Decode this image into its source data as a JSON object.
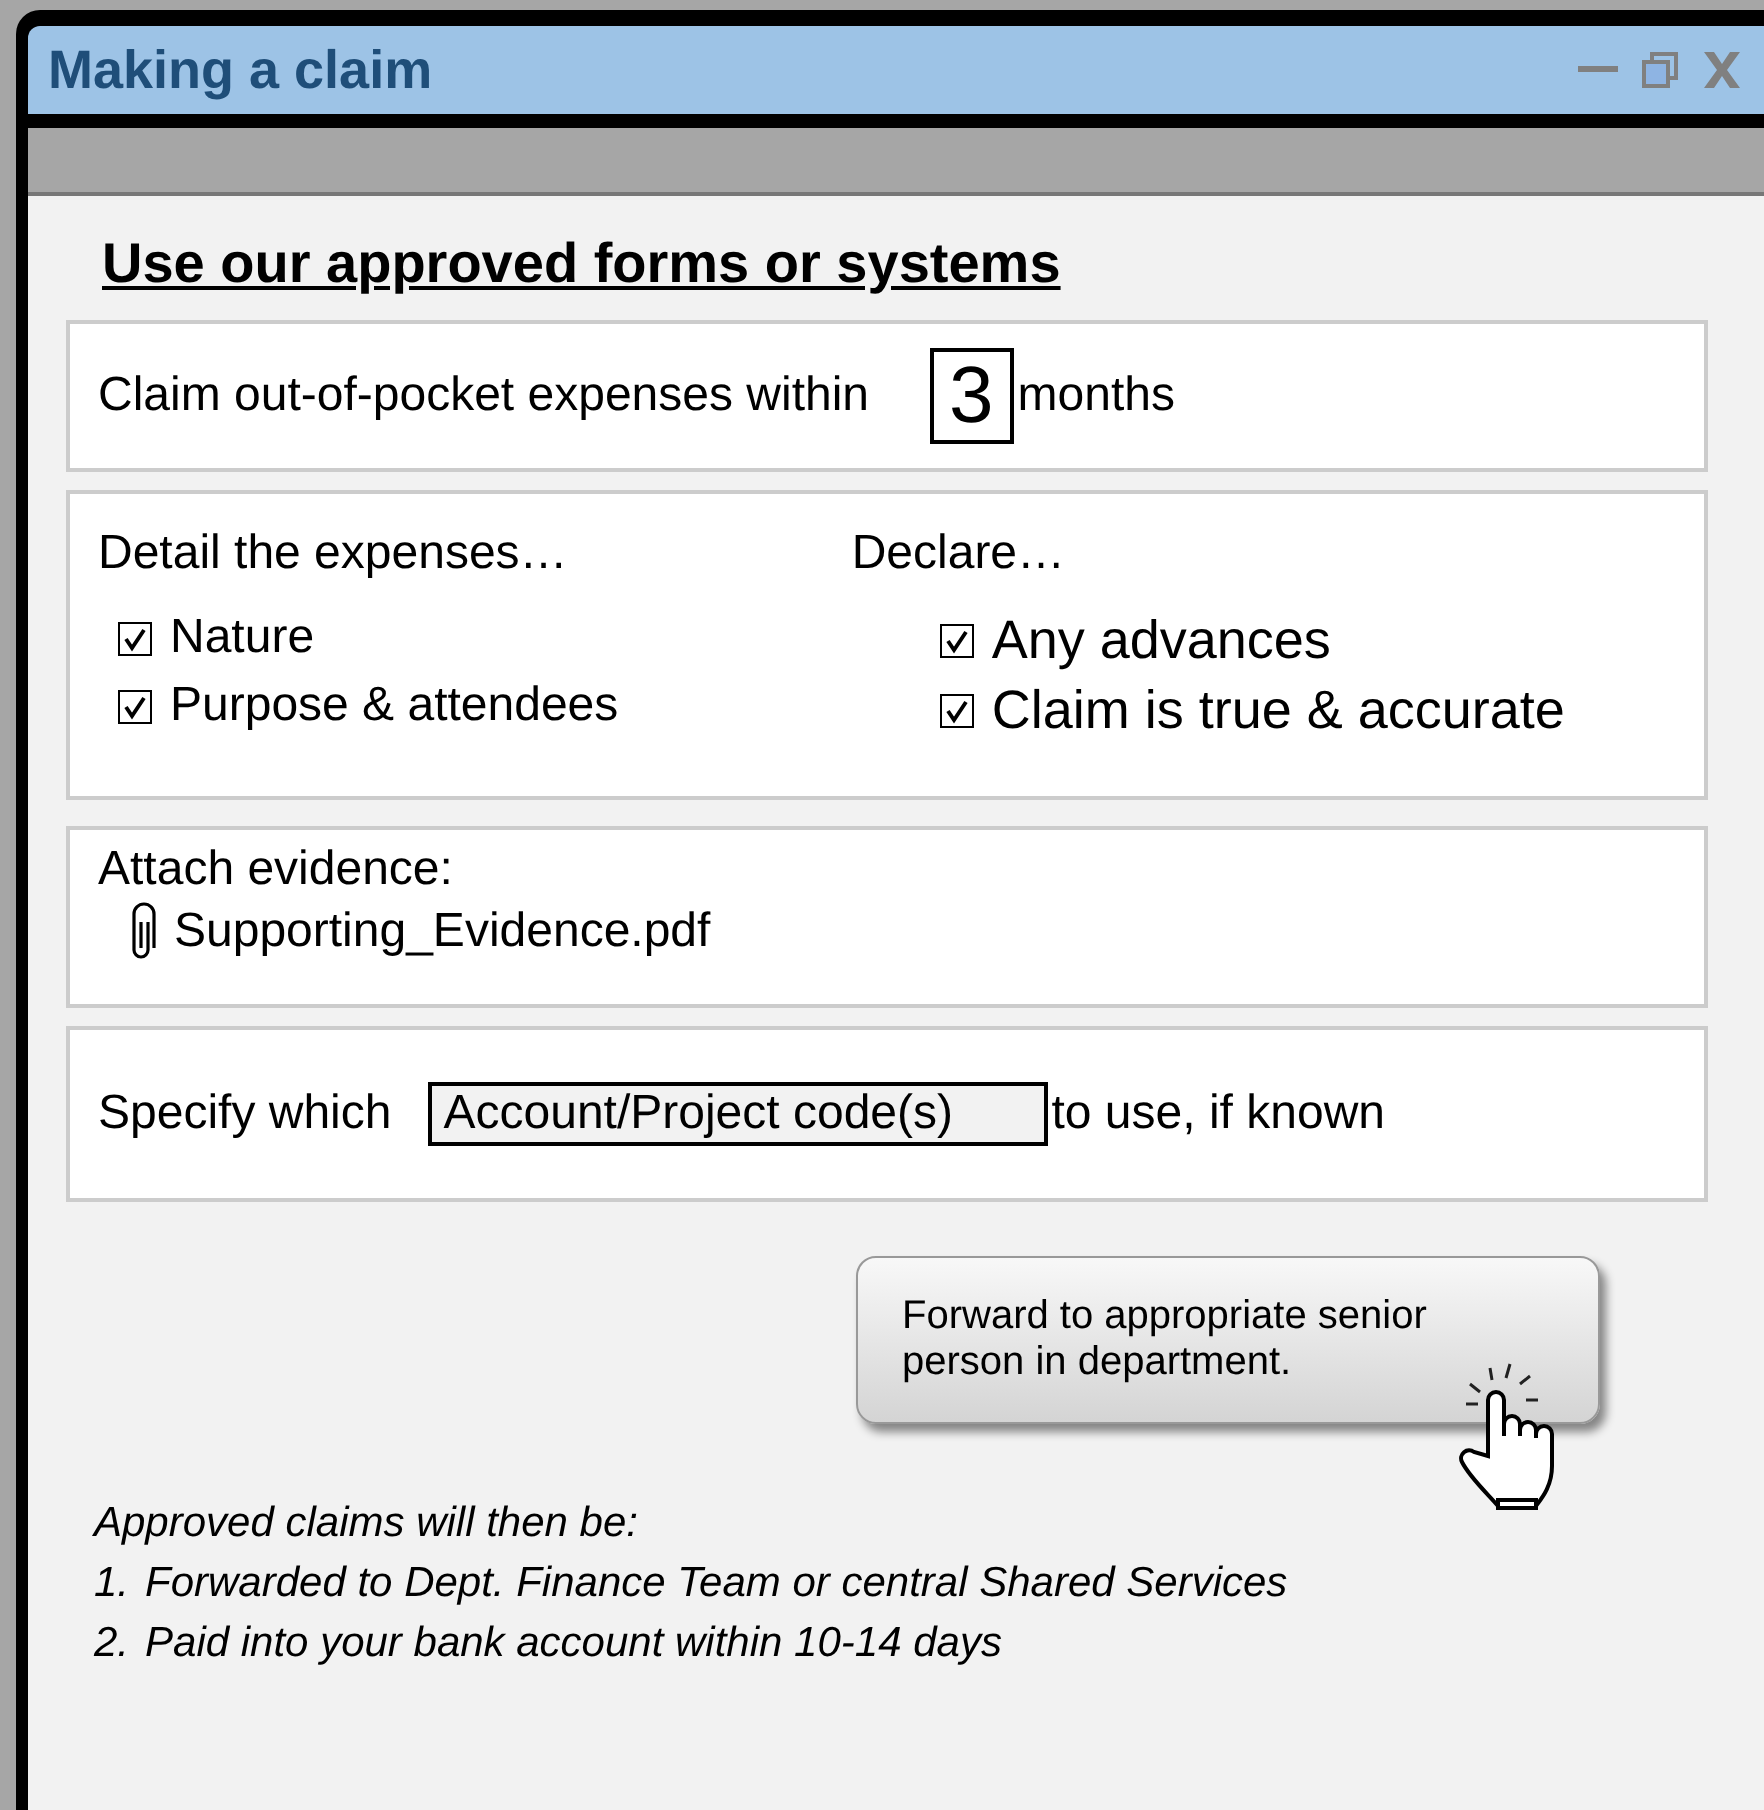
{
  "window": {
    "title": "Making a claim"
  },
  "heading": "Use our approved forms or systems",
  "time_limit": {
    "before": "Claim out-of-pocket expenses within",
    "value": "3",
    "after": "months"
  },
  "detail": {
    "title": "Detail the expenses…",
    "items": [
      {
        "label": "Nature",
        "checked": true
      },
      {
        "label": "Purpose & attendees",
        "checked": true
      }
    ]
  },
  "declare": {
    "title": "Declare…",
    "items": [
      {
        "label": "Any advances",
        "checked": true
      },
      {
        "label": "Claim is true & accurate",
        "checked": true
      }
    ]
  },
  "evidence": {
    "label": "Attach evidence:",
    "file": "Supporting_Evidence.pdf"
  },
  "codes": {
    "before": "Specify which",
    "field": "Account/Project code(s)",
    "after": "to use, if known"
  },
  "forward_button": "Forward to appropriate senior person in department.",
  "notes": {
    "intro": "Approved claims will then be:",
    "steps": [
      {
        "number": "1.",
        "text": "Forwarded to Dept. Finance Team or central Shared Services"
      },
      {
        "number": "2.",
        "text": "Paid into your bank account within 10-14 days"
      }
    ]
  }
}
